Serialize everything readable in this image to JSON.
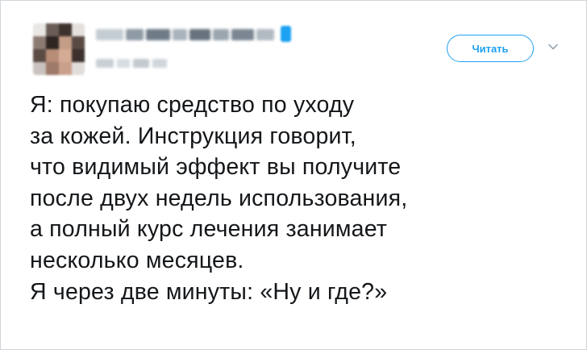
{
  "tweet": {
    "follow_label": "Читать",
    "menu_icon": "chevron-down-icon",
    "lines": [
      "Я: покупаю средство по уходу",
      "за кожей. Инструкция говорит,",
      "что видимый эффект вы получите",
      "после двух недель использования,",
      "а полный курс лечения занимает",
      "несколько месяцев.",
      "Я через две минуты: «Ну и где?»"
    ]
  },
  "colors": {
    "accent": "#1da1f2",
    "text": "#14171a",
    "border": "#cfd6dc"
  }
}
